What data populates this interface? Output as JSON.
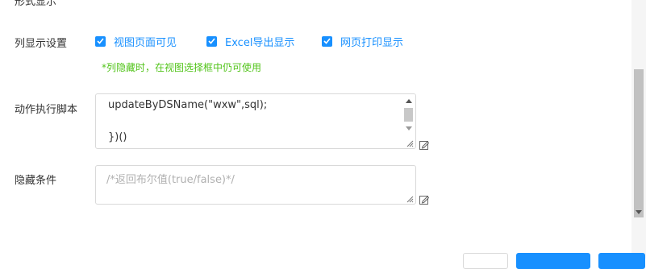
{
  "form": {
    "top_label": "形式显示",
    "column_display": {
      "label": "列显示设置",
      "options": [
        {
          "label": "视图页面可见",
          "checked": true
        },
        {
          "label": "Excel导出显示",
          "checked": true
        },
        {
          "label": "网页打印显示",
          "checked": true
        }
      ],
      "hint": "*列隐藏时，在视图选择框中仍可使用"
    },
    "action_script": {
      "label": "动作执行脚本",
      "lines": [
        "updateByDSName(\"wxw\",sql);",
        "",
        "})()"
      ]
    },
    "hide_condition": {
      "label": "隐藏条件",
      "placeholder": "/*返回布尔值(true/false)*/"
    }
  },
  "colors": {
    "accent": "#1890ff",
    "hint": "#52c41a"
  }
}
